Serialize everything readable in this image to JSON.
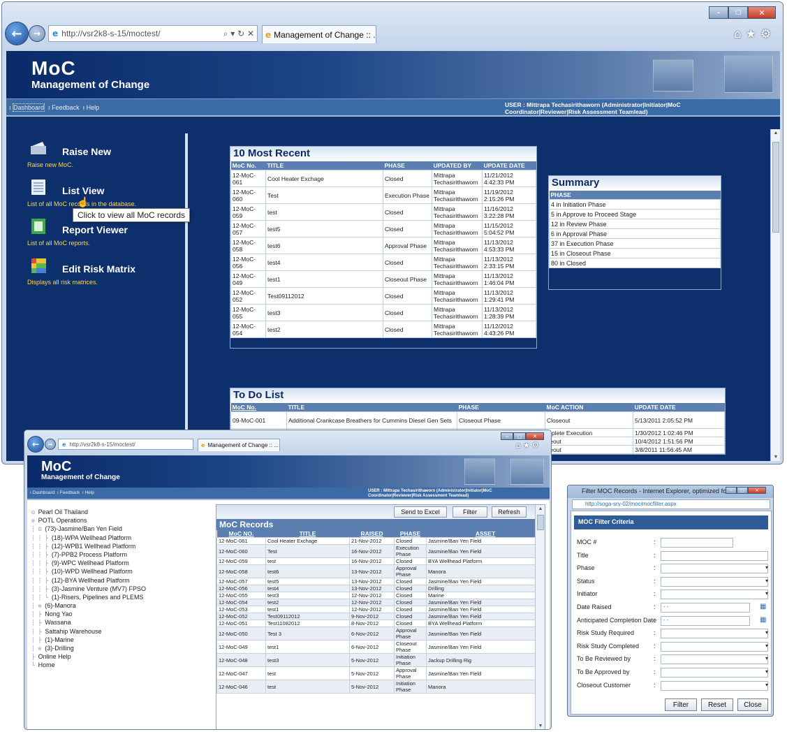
{
  "browser": {
    "url": "http://vsr2k8-s-15/moctest/",
    "tab_title": "Management of Change :: ...",
    "addr_controls": "⌕ ▾ ↻ ✕"
  },
  "app": {
    "title": "MoC",
    "subtitle": "Management of Change",
    "nav": [
      "Dashboard",
      "Feedback",
      "Help"
    ],
    "user": "USER : Mittrapa Techasirithaworn (Administrator|Initiator|MoC Coordinator|Reviewer|Risk Assessment Teamlead)"
  },
  "sidebar": {
    "items": [
      {
        "label": "Raise New",
        "desc": "Raise new MoC."
      },
      {
        "label": "List View",
        "desc": "List of all MoC records in the database."
      },
      {
        "label": "Report Viewer",
        "desc": "List of all MoC reports."
      },
      {
        "label": "Edit Risk Matrix",
        "desc": "Displays all risk matrices."
      }
    ],
    "tooltip": "Click to view all MoC records"
  },
  "recent": {
    "title": "10 Most Recent",
    "columns": [
      "MoC No.",
      "TITLE",
      "PHASE",
      "UPDATED BY",
      "UPDATE DATE"
    ],
    "rows": [
      [
        "12-MoC-061",
        "Cool Heater Exchage",
        "Closed",
        "Mittrapa Techasirithaworn",
        "11/21/2012 4:42:33 PM"
      ],
      [
        "12-MoC-060",
        "Test",
        "Execution Phase",
        "Mittrapa Techasirithaworn",
        "11/19/2012 2:15:26 PM"
      ],
      [
        "12-MoC-059",
        "test",
        "Closed",
        "Mittrapa Techasirithaworn",
        "11/16/2012 3:22:28 PM"
      ],
      [
        "12-MoC-057",
        "test5",
        "Closed",
        "Mittrapa Techasirithaworn",
        "11/15/2012 5:04:52 PM"
      ],
      [
        "12-MoC-058",
        "test6",
        "Approval Phase",
        "Mittrapa Techasirithaworn",
        "11/13/2012 4:53:33 PM"
      ],
      [
        "12-MoC-056",
        "test4",
        "Closed",
        "Mittrapa Techasirithaworn",
        "11/13/2012 2:33:15 PM"
      ],
      [
        "12-MoC-049",
        "test1",
        "Closeout Phase",
        "Mittrapa Techasirithaworn",
        "11/13/2012 1:46:04 PM"
      ],
      [
        "12-MoC-052",
        "Test09112012",
        "Closed",
        "Mittrapa Techasirithaworn",
        "11/13/2012 1:29:41 PM"
      ],
      [
        "12-MoC-055",
        "test3",
        "Closed",
        "Mittrapa Techasirithaworn",
        "11/13/2012 1:28:39 PM"
      ],
      [
        "12-MoC-054",
        "test2",
        "Closed",
        "Mittrapa Techasirithaworn",
        "11/12/2012 4:43:26 PM"
      ]
    ]
  },
  "summary": {
    "title": "Summary",
    "header": "PHASE",
    "rows": [
      "4 in Initiation Phase",
      "5 in Approve to Proceed Stage",
      "12 in Review Phase",
      "6 in Approval Phase",
      "37 in Execution Phase",
      "15 in Closeout Phase",
      "80 in Closed"
    ]
  },
  "todo": {
    "title": "To Do List",
    "columns": [
      "MoC No.",
      "TITLE",
      "PHASE",
      "MoC ACTION",
      "UPDATE DATE"
    ],
    "rows": [
      [
        "09-MoC-001",
        "Additional Crankcase Breathers for Cummins Diesel Gen Sets",
        "Closeout Phase",
        "Closeout",
        "5/13/2011 2:05:52 PM"
      ],
      [
        "",
        "",
        "",
        "mplete Execution",
        "1/30/2012 1:02:46 PM"
      ],
      [
        "",
        "",
        "",
        "seout",
        "10/4/2012 1:51:56 PM"
      ],
      [
        "",
        "",
        "",
        "seout",
        "3/8/2011 11:56:45 AM"
      ]
    ]
  },
  "tree": {
    "items": [
      "Pearl Oil Thailand",
      "POTL Operations",
      "(73)-Jasmine/Ban Yen Field",
      "(18)-WPA Wellhead Platform",
      "(12)-WPB1 Wellhead Platform",
      "(7)-PPB2 Process Platform",
      "(9)-WPC Wellhead Platform",
      "(10)-WPD Wellhead Platform",
      "(12)-BYA Wellhead Platform",
      "(3)-Jasmine Venture (MV7) FPSO",
      "(1)-Risers, Pipelines and PLEMS",
      "(6)-Manora",
      "Nong Yao",
      "Wassana",
      "Sattahip Warehouse",
      "(1)-Marine",
      "(3)-Drilling",
      "Online Help",
      "Home"
    ]
  },
  "records": {
    "title": "MoC Records",
    "buttons": {
      "excel": "Send to Excel",
      "filter": "Filter",
      "refresh": "Refresh"
    },
    "columns": [
      "MoC NO.",
      "TITLE",
      "RAISED",
      "PHASE",
      "ASSET"
    ],
    "rows": [
      [
        "12-MoC-061",
        "Cool Heater Exchage",
        "21-Nov-2012",
        "Closed",
        "Jasmine/Ban Yen Field"
      ],
      [
        "12-MoC-060",
        "Test",
        "16-Nov-2012",
        "Execution Phase",
        "Jasmine/Ban Yen Field"
      ],
      [
        "12-MoC-059",
        "test",
        "16-Nov-2012",
        "Closed",
        "BYA Wellhead Platform"
      ],
      [
        "12-MoC-058",
        "test6",
        "13-Nov-2012",
        "Approval Phase",
        "Manora"
      ],
      [
        "12-MoC-057",
        "test5",
        "13-Nov-2012",
        "Closed",
        "Jasmine/Ban Yen Field"
      ],
      [
        "12-MoC-056",
        "test4",
        "13-Nov-2012",
        "Closed",
        "Drilling"
      ],
      [
        "12-MoC-055",
        "test3",
        "12-Nov-2012",
        "Closed",
        "Marine"
      ],
      [
        "12-MoC-054",
        "test2",
        "12-Nov-2012",
        "Closed",
        "Jasmine/Ban Yen Field"
      ],
      [
        "12-MoC-053",
        "test1",
        "12-Nov-2012",
        "Closed",
        "Jasmine/Ban Yen Field"
      ],
      [
        "12-MoC-052",
        "Test09112012",
        "9-Nov-2012",
        "Closed",
        "Jasmine/Ban Yen Field"
      ],
      [
        "12-MoC-051",
        "Test11082012",
        "8-Nov-2012",
        "Closed",
        "BYA Wellhead Platform"
      ],
      [
        "12-MoC-050",
        "Test 3",
        "6-Nov-2012",
        "Approval Phase",
        "Jasmine/Ban Yen Field"
      ],
      [
        "12-MoC-049",
        "test1",
        "6-Nov-2012",
        "Closeout Phase",
        "Jasmine/Ban Yen Field"
      ],
      [
        "12-MoC-048",
        "test3",
        "5-Nov-2012",
        "Initiation Phase",
        "Jackup Drilling Rig"
      ],
      [
        "12-MoC-047",
        "test",
        "5-Nov-2012",
        "Approval Phase",
        "Jasmine/Ban Yen Field"
      ],
      [
        "12-MoC-046",
        "test",
        "5-Nov-2012",
        "Initiation Phase",
        "Manora"
      ]
    ]
  },
  "filter": {
    "window_title": "Filter MOC Records - Internet Explorer, optimized for B...",
    "url": "http://soga-srv-02/moc/mocfilter.aspx",
    "heading": "MOC Filter Criteria",
    "fields": [
      {
        "label": "MOC #",
        "type": "text",
        "value": ""
      },
      {
        "label": "Title",
        "type": "text",
        "value": ""
      },
      {
        "label": "Phase",
        "type": "select",
        "value": ""
      },
      {
        "label": "Status",
        "type": "select",
        "value": ""
      },
      {
        "label": "Initiator",
        "type": "select",
        "value": ""
      },
      {
        "label": "Date Raised",
        "type": "date",
        "value": "- -"
      },
      {
        "label": "Anticipated Completion Date",
        "type": "date",
        "value": "- -"
      },
      {
        "label": "Risk Study Required",
        "type": "select",
        "value": ""
      },
      {
        "label": "Risk Study Completed",
        "type": "select",
        "value": ""
      },
      {
        "label": "To Be Reviewed by",
        "type": "select",
        "value": ""
      },
      {
        "label": "To Be Approved by",
        "type": "select",
        "value": ""
      },
      {
        "label": "Closeout Customer",
        "type": "select",
        "value": ""
      }
    ],
    "buttons": {
      "filter": "Filter",
      "reset": "Reset",
      "close": "Close"
    }
  },
  "colors": {
    "banner": "#0d2f6b",
    "nav": "#3c6aa4",
    "header": "#5a7fb0",
    "desc": "#ffd84a"
  },
  "icons": [
    "back-arrow-icon",
    "forward-arrow-icon",
    "ie-logo-icon",
    "home-icon",
    "favorites-star-icon",
    "settings-gear-icon",
    "calendar-icon",
    "dropdown-arrow-icon"
  ]
}
